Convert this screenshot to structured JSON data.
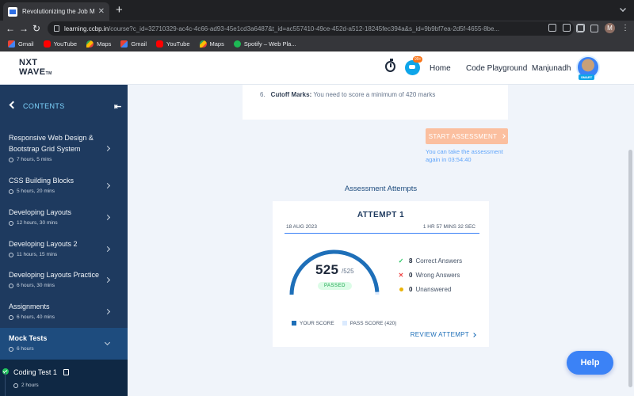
{
  "browser": {
    "tab_title": "Revolutionizing the Job Market",
    "tab_close": "✕",
    "new_tab": "+",
    "url_host": "learning.ccbp.in",
    "url_rest": "/course?c_id=32710329-ac4c-4c66-ad93-45e1cd3a6487&t_id=ac557410-49ce-452d-a512-18245fec394a&s_id=9b9bf7ea-2d5f-4655-8be...",
    "profile_initial": "M",
    "bookmarks": [
      "Gmail",
      "YouTube",
      "Maps",
      "Gmail",
      "YouTube",
      "Maps",
      "Spotify – Web Pla..."
    ]
  },
  "header": {
    "logo_line1a": "NXT",
    "logo_line2a": "WAVE",
    "logo_tm": "TM",
    "notification_count": "99+",
    "nav_home": "Home",
    "nav_playground": "Code Playground",
    "user_name": "Manjunadh",
    "avatar_tag": "SMART"
  },
  "sidebar": {
    "title": "CONTENTS",
    "collapse": "⇤",
    "modules": [
      {
        "title": "Responsive Web Design & Bootstrap Grid System",
        "time": "7 hours, 5 mins"
      },
      {
        "title": "CSS Building Blocks",
        "time": "5 hours, 20 mins"
      },
      {
        "title": "Developing Layouts",
        "time": "12 hours, 30 mins"
      },
      {
        "title": "Developing Layouts 2",
        "time": "11 hours, 15 mins"
      },
      {
        "title": "Developing Layouts Practice",
        "time": "6 hours, 30 mins"
      },
      {
        "title": "Assignments",
        "time": "6 hours, 40 mins"
      },
      {
        "title": "Mock Tests",
        "time": "6 hours"
      }
    ],
    "sub_item": {
      "title": "Coding Test 1",
      "time": "2 hours"
    }
  },
  "rules": {
    "item_number": "6.",
    "item_label": "Cutoff Marks:",
    "item_text": "You need to score a minimum of 420 marks"
  },
  "assessment": {
    "start_label": "START ASSESSMENT",
    "retake_note": "You can take the assessment again in 03:54:40",
    "attempts_title": "Assessment Attempts"
  },
  "attempt": {
    "heading": "ATTEMPT 1",
    "date": "18 AUG 2023",
    "duration": "1 HR 57 MINS 32 SEC",
    "score": "525",
    "max": "/525",
    "status": "PASSED",
    "correct_count": "8",
    "correct_label": "Correct Answers",
    "wrong_count": "0",
    "wrong_label": "Wrong Answers",
    "unanswered_count": "0",
    "unanswered_label": "Unanswered",
    "legend_score": "YOUR SCORE",
    "legend_pass": "PASS SCORE (420)",
    "review_label": "REVIEW ATTEMPT",
    "score_fraction": 1.0,
    "pass_fraction": 0.8
  },
  "colors": {
    "sidebar": "#1e3a5f",
    "accent": "#3b82f6",
    "start_button": "#fbbf9f",
    "score_arc": "#1e6fb8",
    "pass_arc": "#dbeafe"
  },
  "help_label": "Help"
}
